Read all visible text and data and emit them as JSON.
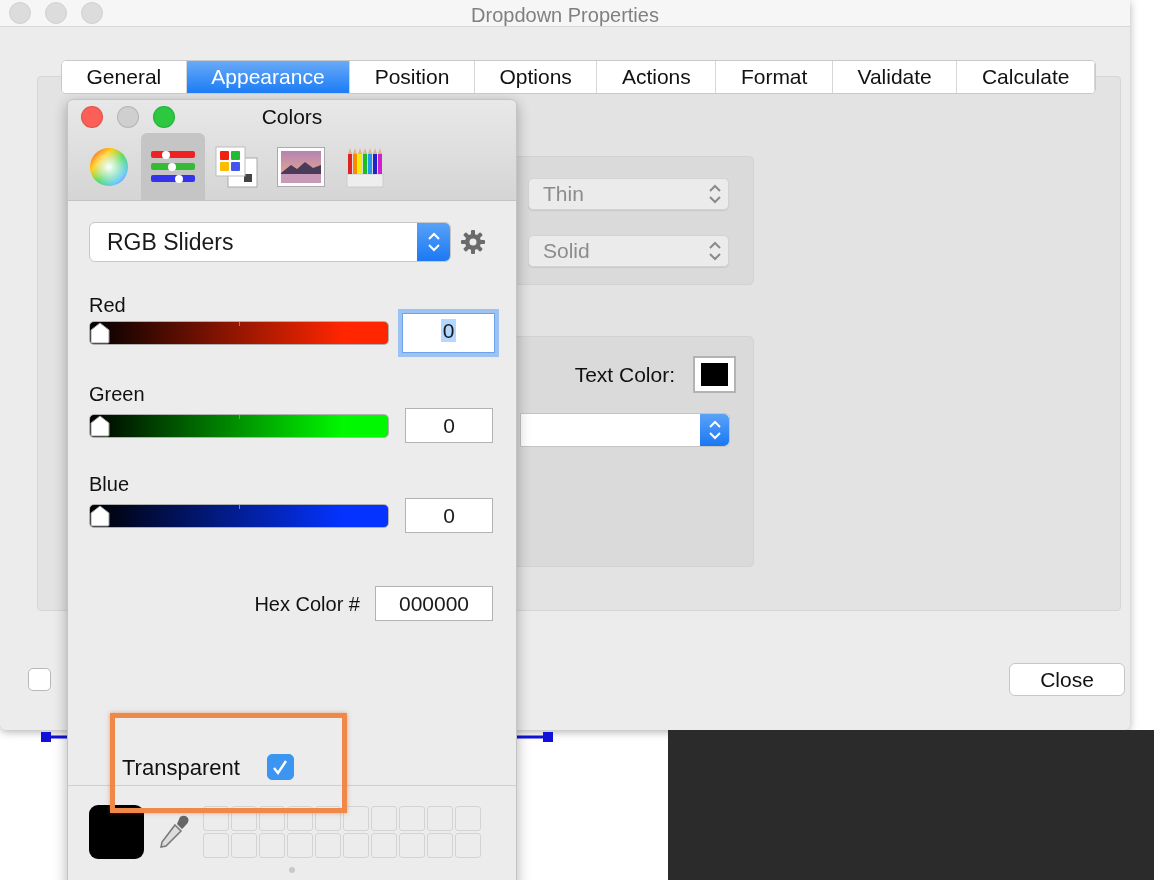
{
  "window": {
    "title": "Dropdown Properties"
  },
  "tabs": [
    {
      "label": "General",
      "selected": false
    },
    {
      "label": "Appearance",
      "selected": true
    },
    {
      "label": "Position",
      "selected": false
    },
    {
      "label": "Options",
      "selected": false
    },
    {
      "label": "Actions",
      "selected": false
    },
    {
      "label": "Format",
      "selected": false
    },
    {
      "label": "Validate",
      "selected": false
    },
    {
      "label": "Calculate",
      "selected": false
    }
  ],
  "border": {
    "thickness": "Thin",
    "style": "Solid"
  },
  "text_color": {
    "label": "Text Color:",
    "color": "#000000"
  },
  "lock_checkbox": {
    "checked": false
  },
  "close_button": "Close",
  "colors_panel": {
    "title": "Colors",
    "modes": [
      {
        "kind": "wheel",
        "selected": false
      },
      {
        "kind": "sliders",
        "selected": true
      },
      {
        "kind": "palettes",
        "selected": false
      },
      {
        "kind": "image",
        "selected": false
      },
      {
        "kind": "pencils",
        "selected": false
      }
    ],
    "model": "RGB Sliders",
    "sliders": [
      {
        "label": "Red",
        "color": "#ff2600",
        "level": 0,
        "value": "0",
        "focused": true
      },
      {
        "label": "Green",
        "color": "#00f900",
        "level": 0,
        "value": "0",
        "focused": false
      },
      {
        "label": "Blue",
        "color": "#0433ff",
        "level": 0,
        "value": "0",
        "focused": false
      }
    ],
    "hex_label": "Hex Color #",
    "hex_value": "000000",
    "transparent": {
      "label": "Transparent",
      "checked": true
    },
    "color_well": {
      "color": "#000000"
    }
  }
}
